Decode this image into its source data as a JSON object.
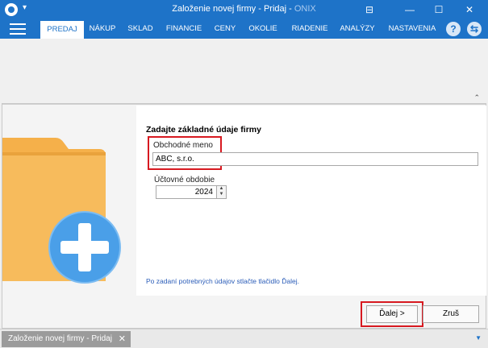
{
  "window": {
    "title": "Založenie novej firmy - Pridaj",
    "title_sep": " - ",
    "brand": "ONIX",
    "controls": [
      "⊟",
      "—",
      "☐",
      "✕"
    ]
  },
  "menu": {
    "items": [
      "PREDAJ",
      "NÁKUP",
      "SKLAD",
      "FINANCIE",
      "CENY",
      "OKOLIE",
      "RIADENIE",
      "ANALÝZY",
      "NASTAVENIA"
    ],
    "active_index": 0,
    "help_icon_glyph": "?",
    "sync_icon_glyph": "⇆"
  },
  "ribbon": {
    "collapse_glyph": "⌃"
  },
  "wizard": {
    "heading": "Zadajte základné údaje firmy",
    "company_name_label": "Obchodné meno",
    "company_name_value": "ABC, s.r.o.",
    "fiscal_period_label": "Účtovné obdobie",
    "fiscal_period_value": "2024",
    "hint": "Po zadaní potrebných údajov stlačte tlačidlo Ďalej.",
    "next_button": "Ďalej >",
    "cancel_button": "Zruš"
  },
  "statusbar": {
    "tab_label": "Založenie novej firmy - Pridaj",
    "tab_close": "✕",
    "arrow_glyph": "▼"
  },
  "colors": {
    "accent": "#1e73c8",
    "highlight": "#d71920",
    "folder": "#f5b04a",
    "plus_circle": "#4a9fe8"
  }
}
